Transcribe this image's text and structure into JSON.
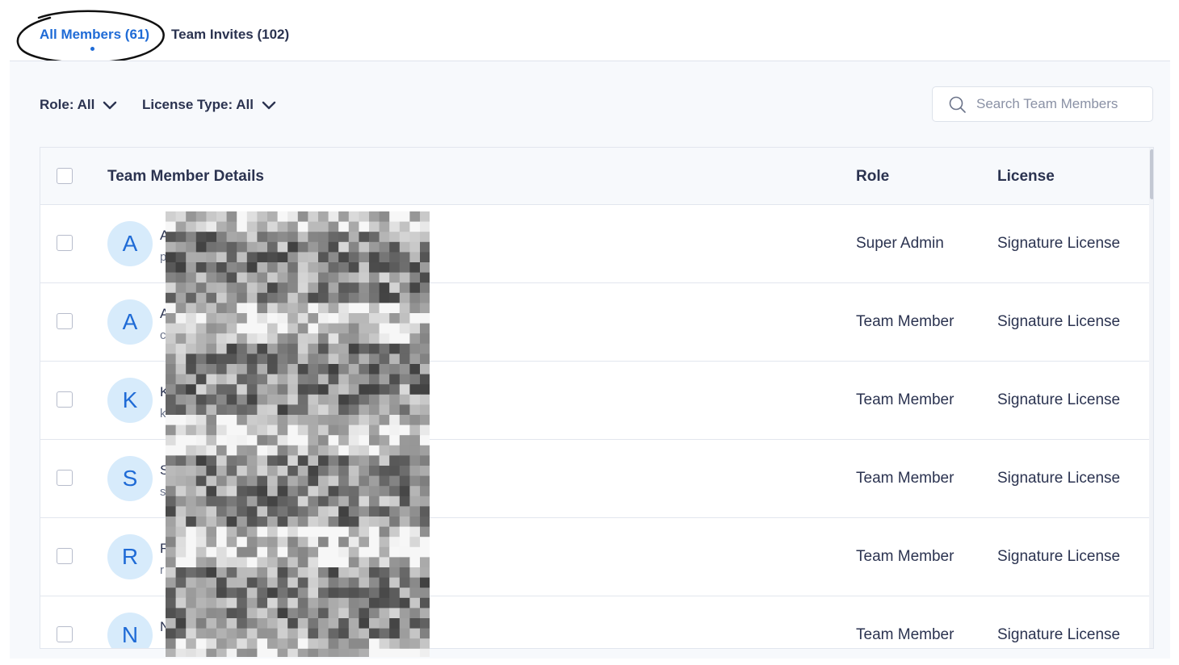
{
  "tabs": [
    {
      "label": "All Members (61)",
      "active": true
    },
    {
      "label": "Team Invites (102)",
      "active": false
    }
  ],
  "filters": {
    "role_label": "Role: All",
    "license_label": "License Type: All"
  },
  "search": {
    "placeholder": "Search Team Members",
    "value": ""
  },
  "table": {
    "columns": [
      "Team Member Details",
      "Role",
      "License"
    ],
    "rows": [
      {
        "initial": "A",
        "name": "A",
        "email": "p",
        "role": "Super Admin",
        "license": "Signature License"
      },
      {
        "initial": "A",
        "name": "A",
        "email": "c",
        "role": "Team Member",
        "license": "Signature License"
      },
      {
        "initial": "K",
        "name": "K",
        "email": "k",
        "role": "Team Member",
        "license": "Signature License"
      },
      {
        "initial": "S",
        "name": "S",
        "email": "s",
        "role": "Team Member",
        "license": "Signature License"
      },
      {
        "initial": "R",
        "name": "R",
        "email": "r",
        "role": "Team Member",
        "license": "Signature License"
      },
      {
        "initial": "N",
        "name": "N",
        "email": "",
        "role": "Team Member",
        "license": "Signature License"
      }
    ]
  },
  "colors": {
    "accent": "#1f6bd6",
    "text": "#2b3350",
    "avatar_bg": "#d7ebfb",
    "panel_bg": "#f7f9fc"
  },
  "icons": {
    "search": "search-icon",
    "dropdown": "chevron-down-icon"
  }
}
